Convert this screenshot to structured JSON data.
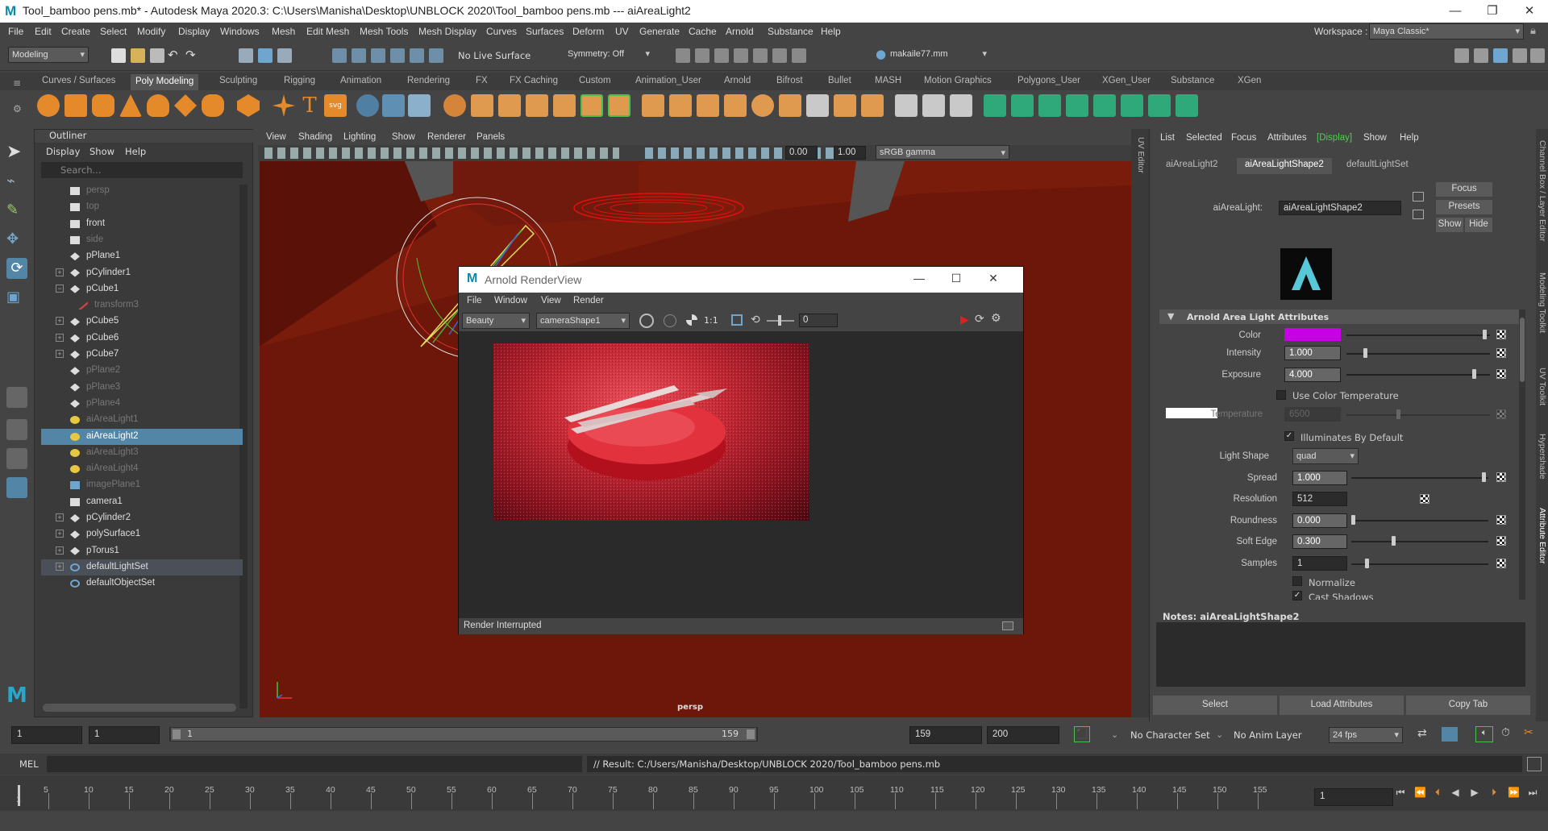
{
  "window": {
    "title": "Tool_bamboo pens.mb* - Autodesk Maya 2020.3: C:\\Users\\Manisha\\Desktop\\UNBLOCK 2020\\Tool_bamboo pens.mb   ---   aiAreaLight2",
    "minimize": "—",
    "restore": "❐",
    "close": "✕"
  },
  "menubar": [
    "File",
    "Edit",
    "Create",
    "Select",
    "Modify",
    "Display",
    "Windows",
    "Mesh",
    "Edit Mesh",
    "Mesh Tools",
    "Mesh Display",
    "Curves",
    "Surfaces",
    "Deform",
    "UV",
    "Generate",
    "Cache",
    "Arnold",
    "Substance",
    "Help"
  ],
  "workspace": {
    "label": "Workspace :",
    "value": "Maya Classic*"
  },
  "statusline": {
    "mode": "Modeling",
    "live_surface": "No Live Surface",
    "symmetry": "Symmetry: Off",
    "user": "makaile77.mm"
  },
  "shelf_tabs": [
    "Curves / Surfaces",
    "Poly Modeling",
    "Sculpting",
    "Rigging",
    "Animation",
    "Rendering",
    "FX",
    "FX Caching",
    "Custom",
    "Animation_User",
    "Arnold",
    "Bifrost",
    "Bullet",
    "MASH",
    "Motion Graphics",
    "Polygons_User",
    "XGen_User",
    "Substance",
    "XGen"
  ],
  "shelf_active": "Poly Modeling",
  "outliner": {
    "title": "Outliner",
    "menu": [
      "Display",
      "Show",
      "Help"
    ],
    "search_placeholder": "Search...",
    "items": [
      {
        "name": "persp",
        "type": "camera",
        "grey": true,
        "expand": ""
      },
      {
        "name": "top",
        "type": "camera",
        "grey": true,
        "expand": ""
      },
      {
        "name": "front",
        "type": "camera",
        "grey": false,
        "expand": ""
      },
      {
        "name": "side",
        "type": "camera",
        "grey": true,
        "expand": ""
      },
      {
        "name": "pPlane1",
        "type": "mesh",
        "grey": false,
        "expand": ""
      },
      {
        "name": "pCylinder1",
        "type": "mesh",
        "grey": false,
        "expand": "+"
      },
      {
        "name": "pCube1",
        "type": "mesh",
        "grey": false,
        "expand": "−"
      },
      {
        "name": "transform3",
        "type": "transform",
        "grey": true,
        "expand": "",
        "indent": true
      },
      {
        "name": "pCube5",
        "type": "mesh",
        "grey": false,
        "expand": "+"
      },
      {
        "name": "pCube6",
        "type": "mesh",
        "grey": false,
        "expand": "+"
      },
      {
        "name": "pCube7",
        "type": "mesh",
        "grey": false,
        "expand": "+"
      },
      {
        "name": "pPlane2",
        "type": "mesh",
        "grey": true,
        "expand": ""
      },
      {
        "name": "pPlane3",
        "type": "mesh",
        "grey": true,
        "expand": ""
      },
      {
        "name": "pPlane4",
        "type": "mesh",
        "grey": true,
        "expand": ""
      },
      {
        "name": "aiAreaLight1",
        "type": "light",
        "grey": true,
        "expand": ""
      },
      {
        "name": "aiAreaLight2",
        "type": "light",
        "grey": false,
        "expand": "",
        "selected": true
      },
      {
        "name": "aiAreaLight3",
        "type": "light",
        "grey": true,
        "expand": ""
      },
      {
        "name": "aiAreaLight4",
        "type": "light",
        "grey": true,
        "expand": ""
      },
      {
        "name": "imagePlane1",
        "type": "image",
        "grey": true,
        "expand": ""
      },
      {
        "name": "camera1",
        "type": "camera",
        "grey": false,
        "expand": ""
      },
      {
        "name": "pCylinder2",
        "type": "mesh",
        "grey": false,
        "expand": "+"
      },
      {
        "name": "polySurface1",
        "type": "mesh",
        "grey": false,
        "expand": "+"
      },
      {
        "name": "pTorus1",
        "type": "mesh",
        "grey": false,
        "expand": "+"
      },
      {
        "name": "defaultLightSet",
        "type": "set",
        "grey": false,
        "expand": "+",
        "highlight": true
      },
      {
        "name": "defaultObjectSet",
        "type": "set",
        "grey": false,
        "expand": ""
      }
    ]
  },
  "viewport": {
    "menu": [
      "View",
      "Shading",
      "Lighting",
      "Show",
      "Renderer",
      "Panels"
    ],
    "exposure": "0.00",
    "gamma": "1.00",
    "color_space": "sRGB gamma",
    "camera_label": "persp",
    "uv_editor": "UV Editor"
  },
  "renderview": {
    "title": "Arnold RenderView",
    "menu": [
      "File",
      "Window",
      "View",
      "Render"
    ],
    "aov": "Beauty",
    "camera": "cameraShape1",
    "ratio": "1:1",
    "exposure": "0",
    "status": "Render Interrupted"
  },
  "attribute_editor": {
    "menu": [
      "List",
      "Selected",
      "Focus",
      "Attributes",
      "[Display]",
      "Show",
      "Help"
    ],
    "tabs": [
      "aiAreaLight2",
      "aiAreaLightShape2",
      "defaultLightSet"
    ],
    "active_tab": "aiAreaLightShape2",
    "node_label": "aiAreaLight:",
    "node_value": "aiAreaLightShape2",
    "buttons": {
      "focus": "Focus",
      "presets": "Presets",
      "show": "Show",
      "hide": "Hide"
    },
    "section": "Arnold Area Light Attributes",
    "color_label": "Color",
    "color_value": "#c800e6",
    "intensity": {
      "label": "Intensity",
      "value": "1.000",
      "slider": 0.12
    },
    "exposure": {
      "label": "Exposure",
      "value": "4.000",
      "slider": 0.9
    },
    "use_color_temperature": "Use Color Temperature",
    "temperature": {
      "label": "Temperature",
      "value": "6500"
    },
    "illuminates": "Illuminates By Default",
    "light_shape": {
      "label": "Light Shape",
      "value": "quad"
    },
    "spread": {
      "label": "Spread",
      "value": "1.000",
      "slider": 0.98
    },
    "resolution": {
      "label": "Resolution",
      "value": "512"
    },
    "roundness": {
      "label": "Roundness",
      "value": "0.000",
      "slider": 0.0
    },
    "soft_edge": {
      "label": "Soft Edge",
      "value": "0.300",
      "slider": 0.3
    },
    "samples": {
      "label": "Samples",
      "value": "1",
      "slider": 0.1
    },
    "normalize": "Normalize",
    "cast_shadows": "Cast Shadows",
    "notes_label": "Notes:  aiAreaLightShape2",
    "bottom_buttons": [
      "Select",
      "Load Attributes",
      "Copy Tab"
    ],
    "side_tabs": [
      "Channel Box / Layer Editor",
      "Modeling Toolkit",
      "UV Toolkit",
      "Hypershade",
      "Attribute Editor"
    ]
  },
  "time_range": {
    "start": "1",
    "playback_start": "1",
    "range_start": "1",
    "range_end": "159",
    "playback_end": "159",
    "end": "200",
    "character_set": "No Character Set",
    "anim_layer": "No Anim Layer",
    "fps": "24 fps"
  },
  "command_line": {
    "label": "MEL",
    "result": "// Result: C:/Users/Manisha/Desktop/UNBLOCK 2020/Tool_bamboo pens.mb"
  },
  "timeline": {
    "ticks": [
      "5",
      "10",
      "15",
      "20",
      "25",
      "30",
      "35",
      "40",
      "45",
      "50",
      "55",
      "60",
      "65",
      "70",
      "75",
      "80",
      "85",
      "90",
      "95",
      "100",
      "105",
      "110",
      "115",
      "120",
      "125",
      "130",
      "135",
      "140",
      "145",
      "150",
      "155"
    ],
    "first": "1",
    "current_frame": "1"
  },
  "colors": {
    "accent_blue": "#5285a6",
    "viewport_bg": "#6a1709",
    "light_color": "#c800e6"
  }
}
